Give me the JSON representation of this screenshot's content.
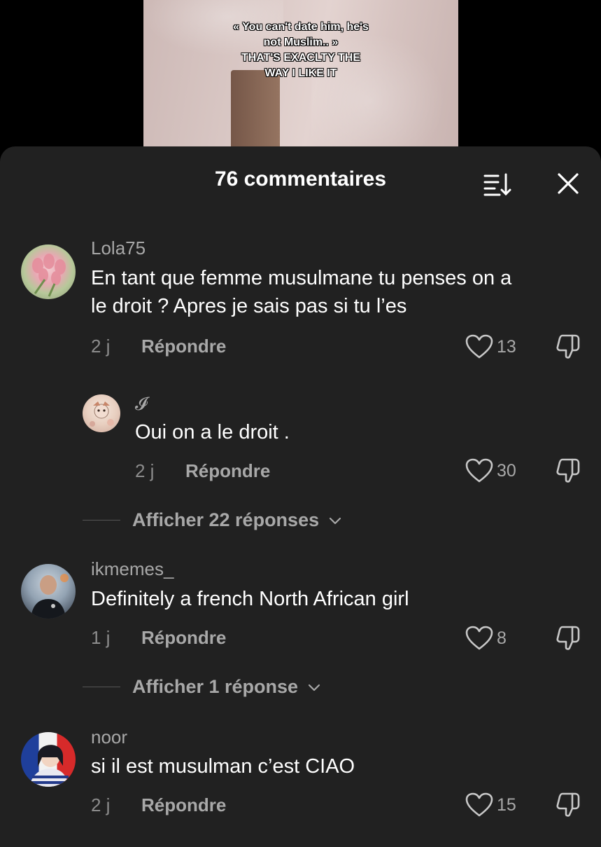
{
  "video": {
    "caption_lines": [
      "« You can't date him, he's",
      "not Muslim.. »",
      "THAT'S EXACLTY THE",
      "WAY I LIKE IT"
    ]
  },
  "sheet": {
    "title": "76 commentaires",
    "sort_icon": "sort-icon",
    "close_icon": "close-icon"
  },
  "comments": [
    {
      "username": "Lola75",
      "text_lines": [
        "En tant que femme musulmane tu penses on a",
        "le droit ? Apres je sais pas si tu l’es"
      ],
      "time": "2 j",
      "reply_label": "Répondre",
      "likes": "13"
    },
    {
      "username": "𝓘",
      "text_lines": [
        "Oui on a le droit ."
      ],
      "time": "2 j",
      "reply_label": "Répondre",
      "likes": "30"
    },
    {
      "username": "ikmemes_",
      "text_lines": [
        "Definitely a french North African girl"
      ],
      "time": "1 j",
      "reply_label": "Répondre",
      "likes": "8"
    },
    {
      "username": "noor",
      "text_lines": [
        "si il est musulman c’est CIAO"
      ],
      "time": "2 j",
      "reply_label": "Répondre",
      "likes": "15"
    }
  ],
  "show_replies": [
    {
      "label": "Afficher 22 réponses"
    },
    {
      "label": "Afficher 1 réponse"
    }
  ],
  "colors": {
    "sheet_bg": "#212121",
    "text": "#ffffff",
    "muted": "#a8a8a8"
  }
}
